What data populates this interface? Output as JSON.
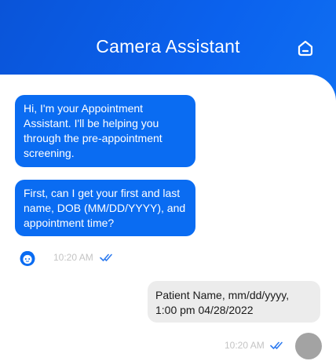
{
  "header": {
    "title": "Camera Assistant",
    "home_icon": "home-icon",
    "background_color": "#0b62ee"
  },
  "messages": [
    {
      "sender": "bot",
      "text": "Hi, I'm your Appointment Assistant. I'll be helping you through the pre-appointment screening."
    },
    {
      "sender": "bot",
      "text": "First, can I get your first and last name, DOB (MM/DD/YYYY), and appointment time?",
      "time": "10:20 AM",
      "status_icon": "double-check-icon"
    },
    {
      "sender": "user",
      "text": "Patient Name, mm/dd/yyyy, 1:00 pm 04/28/2022",
      "time": "10:20 AM",
      "status_icon": "double-check-icon"
    }
  ],
  "colors": {
    "bot_bubble": "#0a6cf2",
    "user_bubble": "#ececec",
    "read_ticks": "#2f7cf0",
    "timestamp": "#c4c4c4"
  }
}
